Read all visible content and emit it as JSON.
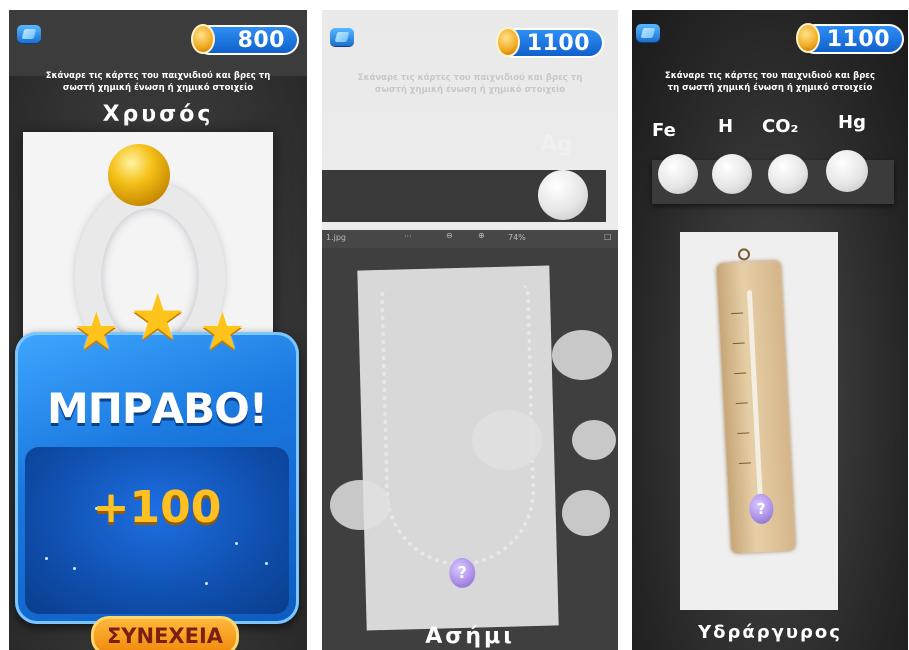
{
  "instruction_text": "Σκάναρε τις κάρτες του παιχνιδιού και βρες τη σωστή χημική ένωση ή χημικό στοιχείο",
  "panel_1": {
    "score": "800",
    "word": "Χρυσός",
    "stars": 3,
    "reward_title": "ΜΠΡΑΒΟ!",
    "reward_points": "+100",
    "continue_label": "ΣΥΝΕΧΕΙΑ"
  },
  "panel_2": {
    "score": "1100",
    "option_symbol": "Ag",
    "viewer": {
      "filename": "1.jpg",
      "zoom": "74%"
    },
    "word": "Ασήμι"
  },
  "panel_3": {
    "score": "1100",
    "options": [
      "Fe",
      "H",
      "CO₂",
      "Hg"
    ],
    "word": "Υδράργυρος"
  },
  "colors": {
    "coin_blue": "#1e74dd",
    "gold": "#f6c21a",
    "reward_blue": "#1a78df",
    "button_orange": "#f59d1f"
  }
}
